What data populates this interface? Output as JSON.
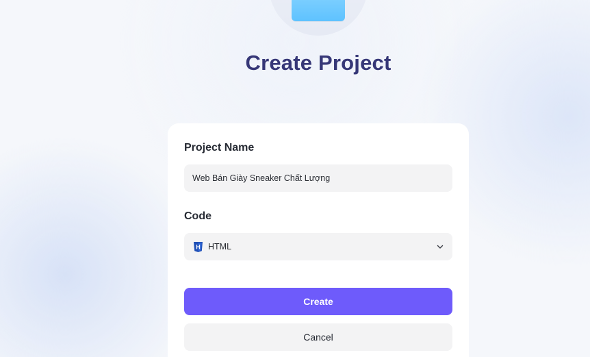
{
  "header": {
    "title": "Create Project",
    "illustration_icon": "folder-illustration-icon"
  },
  "form": {
    "project_name_label": "Project Name",
    "project_name_value": "Web Bán Giày Sneaker Chất Lượng",
    "code_label": "Code",
    "code_selected": "HTML",
    "code_icon": "html-icon",
    "create_label": "Create",
    "cancel_label": "Cancel"
  },
  "colors": {
    "title": "#363777",
    "primary_button": "#6e5bfb",
    "input_background": "#f3f3f4",
    "illustration": "#6cc8ff"
  }
}
